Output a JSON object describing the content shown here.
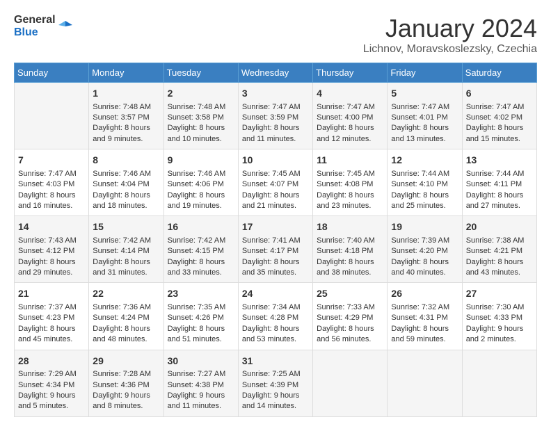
{
  "header": {
    "logo_general": "General",
    "logo_blue": "Blue",
    "month_title": "January 2024",
    "location": "Lichnov, Moravskoslezsky, Czechia"
  },
  "days_of_week": [
    "Sunday",
    "Monday",
    "Tuesday",
    "Wednesday",
    "Thursday",
    "Friday",
    "Saturday"
  ],
  "weeks": [
    [
      {
        "day": "",
        "sunrise": "",
        "sunset": "",
        "daylight": ""
      },
      {
        "day": "1",
        "sunrise": "Sunrise: 7:48 AM",
        "sunset": "Sunset: 3:57 PM",
        "daylight": "Daylight: 8 hours and 9 minutes."
      },
      {
        "day": "2",
        "sunrise": "Sunrise: 7:48 AM",
        "sunset": "Sunset: 3:58 PM",
        "daylight": "Daylight: 8 hours and 10 minutes."
      },
      {
        "day": "3",
        "sunrise": "Sunrise: 7:47 AM",
        "sunset": "Sunset: 3:59 PM",
        "daylight": "Daylight: 8 hours and 11 minutes."
      },
      {
        "day": "4",
        "sunrise": "Sunrise: 7:47 AM",
        "sunset": "Sunset: 4:00 PM",
        "daylight": "Daylight: 8 hours and 12 minutes."
      },
      {
        "day": "5",
        "sunrise": "Sunrise: 7:47 AM",
        "sunset": "Sunset: 4:01 PM",
        "daylight": "Daylight: 8 hours and 13 minutes."
      },
      {
        "day": "6",
        "sunrise": "Sunrise: 7:47 AM",
        "sunset": "Sunset: 4:02 PM",
        "daylight": "Daylight: 8 hours and 15 minutes."
      }
    ],
    [
      {
        "day": "7",
        "sunrise": "Sunrise: 7:47 AM",
        "sunset": "Sunset: 4:03 PM",
        "daylight": "Daylight: 8 hours and 16 minutes."
      },
      {
        "day": "8",
        "sunrise": "Sunrise: 7:46 AM",
        "sunset": "Sunset: 4:04 PM",
        "daylight": "Daylight: 8 hours and 18 minutes."
      },
      {
        "day": "9",
        "sunrise": "Sunrise: 7:46 AM",
        "sunset": "Sunset: 4:06 PM",
        "daylight": "Daylight: 8 hours and 19 minutes."
      },
      {
        "day": "10",
        "sunrise": "Sunrise: 7:45 AM",
        "sunset": "Sunset: 4:07 PM",
        "daylight": "Daylight: 8 hours and 21 minutes."
      },
      {
        "day": "11",
        "sunrise": "Sunrise: 7:45 AM",
        "sunset": "Sunset: 4:08 PM",
        "daylight": "Daylight: 8 hours and 23 minutes."
      },
      {
        "day": "12",
        "sunrise": "Sunrise: 7:44 AM",
        "sunset": "Sunset: 4:10 PM",
        "daylight": "Daylight: 8 hours and 25 minutes."
      },
      {
        "day": "13",
        "sunrise": "Sunrise: 7:44 AM",
        "sunset": "Sunset: 4:11 PM",
        "daylight": "Daylight: 8 hours and 27 minutes."
      }
    ],
    [
      {
        "day": "14",
        "sunrise": "Sunrise: 7:43 AM",
        "sunset": "Sunset: 4:12 PM",
        "daylight": "Daylight: 8 hours and 29 minutes."
      },
      {
        "day": "15",
        "sunrise": "Sunrise: 7:42 AM",
        "sunset": "Sunset: 4:14 PM",
        "daylight": "Daylight: 8 hours and 31 minutes."
      },
      {
        "day": "16",
        "sunrise": "Sunrise: 7:42 AM",
        "sunset": "Sunset: 4:15 PM",
        "daylight": "Daylight: 8 hours and 33 minutes."
      },
      {
        "day": "17",
        "sunrise": "Sunrise: 7:41 AM",
        "sunset": "Sunset: 4:17 PM",
        "daylight": "Daylight: 8 hours and 35 minutes."
      },
      {
        "day": "18",
        "sunrise": "Sunrise: 7:40 AM",
        "sunset": "Sunset: 4:18 PM",
        "daylight": "Daylight: 8 hours and 38 minutes."
      },
      {
        "day": "19",
        "sunrise": "Sunrise: 7:39 AM",
        "sunset": "Sunset: 4:20 PM",
        "daylight": "Daylight: 8 hours and 40 minutes."
      },
      {
        "day": "20",
        "sunrise": "Sunrise: 7:38 AM",
        "sunset": "Sunset: 4:21 PM",
        "daylight": "Daylight: 8 hours and 43 minutes."
      }
    ],
    [
      {
        "day": "21",
        "sunrise": "Sunrise: 7:37 AM",
        "sunset": "Sunset: 4:23 PM",
        "daylight": "Daylight: 8 hours and 45 minutes."
      },
      {
        "day": "22",
        "sunrise": "Sunrise: 7:36 AM",
        "sunset": "Sunset: 4:24 PM",
        "daylight": "Daylight: 8 hours and 48 minutes."
      },
      {
        "day": "23",
        "sunrise": "Sunrise: 7:35 AM",
        "sunset": "Sunset: 4:26 PM",
        "daylight": "Daylight: 8 hours and 51 minutes."
      },
      {
        "day": "24",
        "sunrise": "Sunrise: 7:34 AM",
        "sunset": "Sunset: 4:28 PM",
        "daylight": "Daylight: 8 hours and 53 minutes."
      },
      {
        "day": "25",
        "sunrise": "Sunrise: 7:33 AM",
        "sunset": "Sunset: 4:29 PM",
        "daylight": "Daylight: 8 hours and 56 minutes."
      },
      {
        "day": "26",
        "sunrise": "Sunrise: 7:32 AM",
        "sunset": "Sunset: 4:31 PM",
        "daylight": "Daylight: 8 hours and 59 minutes."
      },
      {
        "day": "27",
        "sunrise": "Sunrise: 7:30 AM",
        "sunset": "Sunset: 4:33 PM",
        "daylight": "Daylight: 9 hours and 2 minutes."
      }
    ],
    [
      {
        "day": "28",
        "sunrise": "Sunrise: 7:29 AM",
        "sunset": "Sunset: 4:34 PM",
        "daylight": "Daylight: 9 hours and 5 minutes."
      },
      {
        "day": "29",
        "sunrise": "Sunrise: 7:28 AM",
        "sunset": "Sunset: 4:36 PM",
        "daylight": "Daylight: 9 hours and 8 minutes."
      },
      {
        "day": "30",
        "sunrise": "Sunrise: 7:27 AM",
        "sunset": "Sunset: 4:38 PM",
        "daylight": "Daylight: 9 hours and 11 minutes."
      },
      {
        "day": "31",
        "sunrise": "Sunrise: 7:25 AM",
        "sunset": "Sunset: 4:39 PM",
        "daylight": "Daylight: 9 hours and 14 minutes."
      },
      {
        "day": "",
        "sunrise": "",
        "sunset": "",
        "daylight": ""
      },
      {
        "day": "",
        "sunrise": "",
        "sunset": "",
        "daylight": ""
      },
      {
        "day": "",
        "sunrise": "",
        "sunset": "",
        "daylight": ""
      }
    ]
  ]
}
